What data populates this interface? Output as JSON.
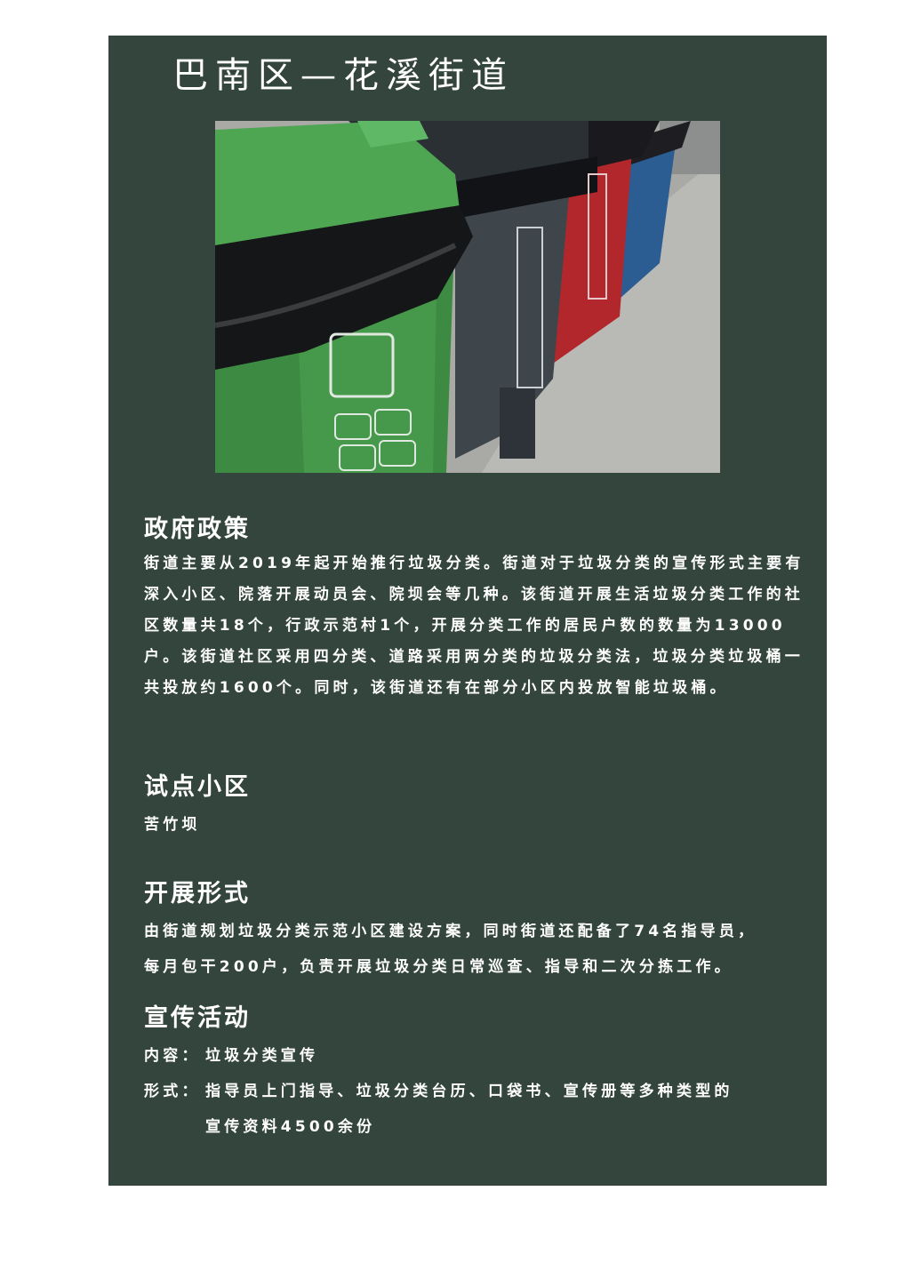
{
  "title": "巴南区—花溪街道",
  "photo": {
    "description_icon": "garbage-bins-photo"
  },
  "sections": {
    "policy": {
      "heading": "政府政策",
      "body": "街道主要从2019年起开始推行垃圾分类。街道对于垃圾分类的宣传形式主要有深入小区、院落开展动员会、院坝会等几种。该街道开展生活垃圾分类工作的社区数量共18个，行政示范村1个，开展分类工作的居民户数的数量为13000户。该街道社区采用四分类、道路采用两分类的垃圾分类法，垃圾分类垃圾桶一共投放约1600个。同时，该街道还有在部分小区内投放智能垃圾桶。"
    },
    "pilot": {
      "heading": "试点小区",
      "body": "苦竹坝"
    },
    "form": {
      "heading": "开展形式",
      "line1": "由街道规划垃圾分类示范小区建设方案，同时街道还配备了74名指导员，",
      "line2": "每月包干200户，负责开展垃圾分类日常巡查、指导和二次分拣工作。"
    },
    "promo": {
      "heading": "宣传活动",
      "content_label": "内容：",
      "content_value": "垃圾分类宣传",
      "form_label": "形式：",
      "form_line1": "指导员上门指导、垃圾分类台历、口袋书、宣传册等多种类型的",
      "form_line2": "宣传资料4500余份"
    }
  }
}
